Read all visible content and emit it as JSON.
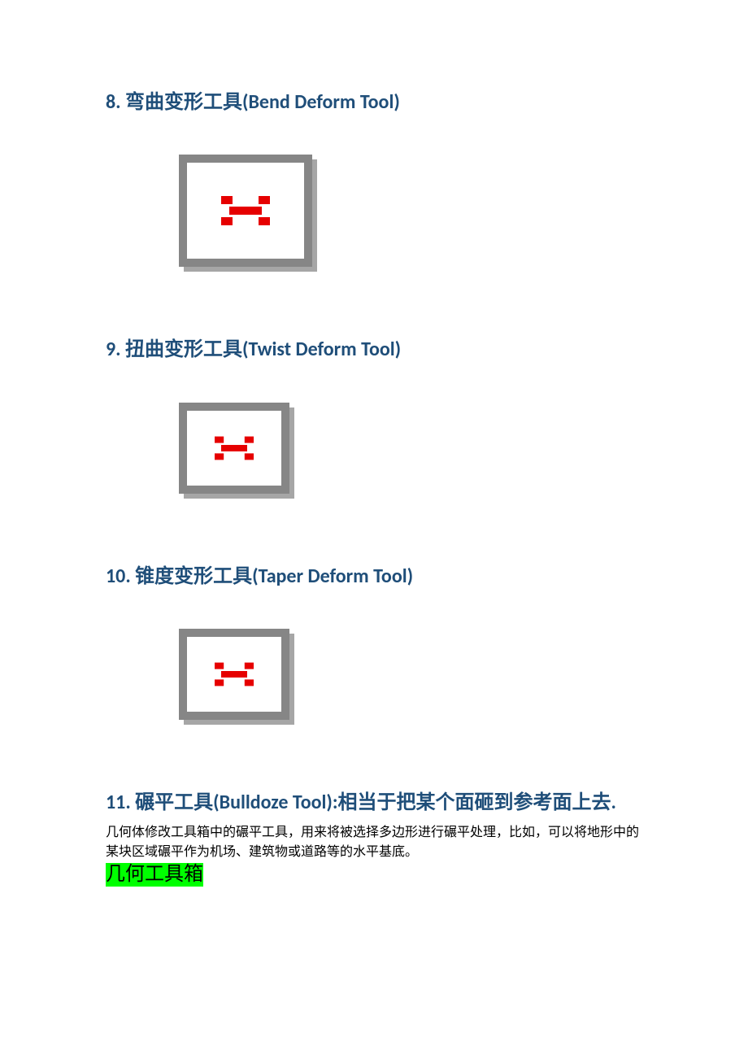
{
  "sections": {
    "s8": {
      "heading": "8. 弯曲变形工具(Bend Deform Tool)"
    },
    "s9": {
      "heading": "9. 扭曲变形工具(Twist Deform Tool)"
    },
    "s10": {
      "heading": "10. 锥度变形工具(Taper Deform Tool)"
    },
    "s11": {
      "heading": "11. 碾平工具(Bulldoze Tool):相当于把某个面砸到参考面上去.",
      "body": "几何体修改工具箱中的碾平工具，用来将被选择多边形进行碾平处理，比如，可以将地形中的某块区域碾平作为机场、建筑物或道路等的水平基底。",
      "highlight": "几何工具箱"
    }
  }
}
